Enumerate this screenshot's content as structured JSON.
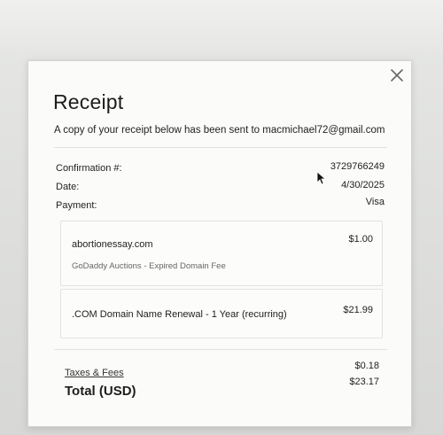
{
  "receipt": {
    "title": "Receipt",
    "sent_note": "A copy of your receipt below has been sent to macmichael72@gmail.com",
    "close_icon": "close-icon",
    "meta": {
      "confirmation_label": "Confirmation #:",
      "confirmation_value": "3729766249",
      "date_label": "Date:",
      "date_value": "4/30/2025",
      "payment_label": "Payment:",
      "payment_value": "Visa"
    },
    "items": [
      {
        "name": "abortionessay.com",
        "description": "GoDaddy Auctions - Expired Domain Fee",
        "price": "$1.00"
      },
      {
        "name": ".COM Domain Name Renewal - 1 Year (recurring)",
        "price": "$21.99"
      }
    ],
    "taxes_label": "Taxes & Fees",
    "taxes_amount": "$0.18",
    "total_label": "Total (USD)",
    "total_amount": "$23.17"
  },
  "colors": {
    "modal_background": "#fbfbfa",
    "text": "#1d1d1d",
    "divider": "#e1e2df"
  }
}
